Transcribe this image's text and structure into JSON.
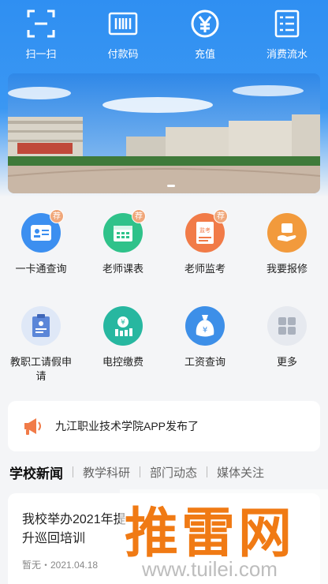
{
  "quick_actions": [
    {
      "label": "扫一扫",
      "icon": "scan-icon"
    },
    {
      "label": "付款码",
      "icon": "barcode-icon"
    },
    {
      "label": "充值",
      "icon": "yuan-icon"
    },
    {
      "label": "消费流水",
      "icon": "list-icon"
    }
  ],
  "grid": [
    {
      "label": "一卡通查询",
      "icon": "id-card-icon",
      "badge": "荐",
      "color": "#3c8ff0"
    },
    {
      "label": "老师课表",
      "icon": "calendar-icon",
      "badge": "荐",
      "color": "#2fc28a"
    },
    {
      "label": "老师监考",
      "icon": "exam-paper-icon",
      "badge": "荐",
      "color": "#f17b48",
      "inner": "监考"
    },
    {
      "label": "我要报修",
      "icon": "repair-hand-icon",
      "badge": "",
      "color": "#f29a3c"
    },
    {
      "label": "教职工请假申请",
      "icon": "leave-form-icon",
      "badge": "",
      "color": "#5b86d8"
    },
    {
      "label": "电控缴费",
      "icon": "electric-bill-icon",
      "badge": "",
      "color": "#27b7a0"
    },
    {
      "label": "工资查询",
      "icon": "money-bag-icon",
      "badge": "",
      "color": "#3d8fe8"
    },
    {
      "label": "更多",
      "icon": "more-apps-icon",
      "badge": "",
      "color": "#c4c9d3"
    }
  ],
  "notice": {
    "text": "九江职业技术学院APP发布了",
    "icon": "megaphone-icon"
  },
  "tabs": [
    "学校新闻",
    "教学科研",
    "部门动态",
    "媒体关注"
  ],
  "news": {
    "title": "我校举办2021年提升巡回培训",
    "meta": "暂无・2021.04.18"
  },
  "watermark": {
    "text": "推雷网",
    "url": "www.tuilei.com"
  }
}
